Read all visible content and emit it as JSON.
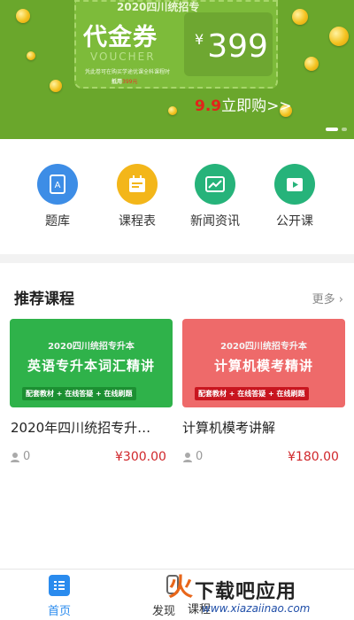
{
  "banner": {
    "top_text": "2020四川统招专",
    "voucher_cn": "代金券",
    "voucher_en": "VOUCHER",
    "desc": "凭此卷可在购买学途优课全科课程时",
    "desc2_prefix": "抵用",
    "desc2_amount": "399元",
    "price_symbol": "¥",
    "price": "399",
    "cta_num": "9.9",
    "cta_text": "立即购>>"
  },
  "quick_menu": [
    {
      "label": "题库",
      "icon": "question-bank-icon",
      "color": "#3d8de6"
    },
    {
      "label": "课程表",
      "icon": "schedule-icon",
      "color": "#f3b61a"
    },
    {
      "label": "新闻资讯",
      "icon": "news-icon",
      "color": "#26b37a"
    },
    {
      "label": "公开课",
      "icon": "open-class-icon",
      "color": "#26b37a"
    }
  ],
  "recommended": {
    "title": "推荐课程",
    "more": "更多 ›",
    "courses": [
      {
        "banner_line1": "2020四川统招专升本",
        "banner_line2": "英语专升本词汇精讲",
        "banner_tag": "配套教材 + 在线答疑 + 在线刷题",
        "name": "2020年四川统招专升…",
        "students": "0",
        "price": "¥300.00",
        "color": "#2fb24a"
      },
      {
        "banner_line1": "2020四川统招专升本",
        "banner_line2": "计算机模考精讲",
        "banner_tag": "配套教材 + 在线答疑 + 在线刷题",
        "name": "计算机模考讲解",
        "students": "0",
        "price": "¥180.00",
        "color": "#ee6a6a"
      }
    ]
  },
  "tabbar": {
    "home": "首页",
    "discover": "发现",
    "courses": "课程"
  },
  "watermark": {
    "main": "下载吧应用",
    "url": "www.xiazaiinao.com"
  }
}
